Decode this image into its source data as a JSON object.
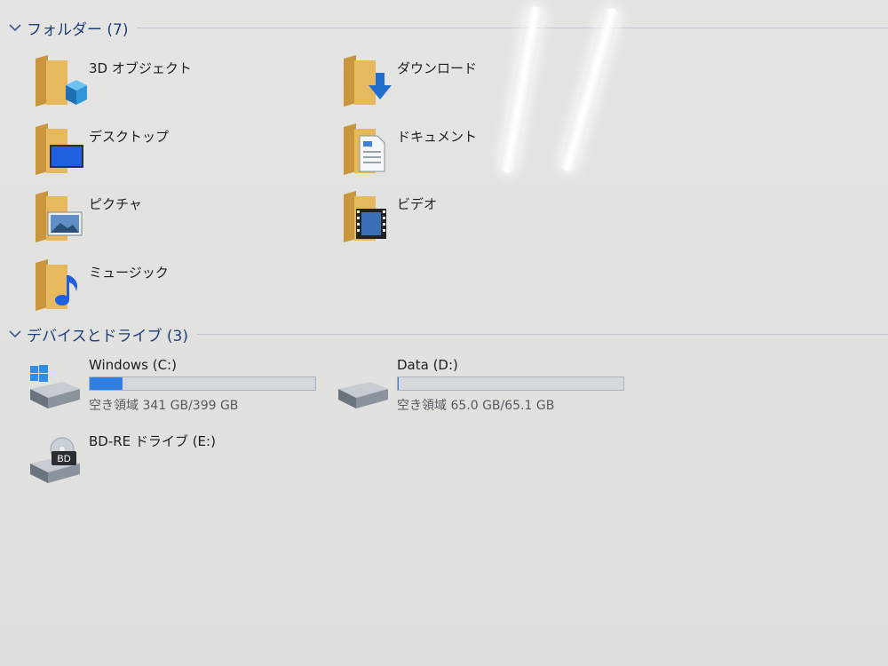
{
  "folders_section": {
    "title": "フォルダー (7)",
    "items": [
      {
        "label": "3D オブジェクト",
        "icon": "3d-objects-folder-icon"
      },
      {
        "label": "ダウンロード",
        "icon": "downloads-folder-icon"
      },
      {
        "label": "デスクトップ",
        "icon": "desktop-folder-icon"
      },
      {
        "label": "ドキュメント",
        "icon": "documents-folder-icon"
      },
      {
        "label": "ピクチャ",
        "icon": "pictures-folder-icon"
      },
      {
        "label": "ビデオ",
        "icon": "videos-folder-icon"
      },
      {
        "label": "ミュージック",
        "icon": "music-folder-icon"
      }
    ]
  },
  "devices_section": {
    "title": "デバイスとドライブ (3)",
    "drives": [
      {
        "name": "Windows (C:)",
        "free_text": "空き領域 341 GB/399 GB",
        "used_fraction": 0.145,
        "icon": "windows-drive-icon"
      },
      {
        "name": "Data (D:)",
        "free_text": "空き領域 65.0 GB/65.1 GB",
        "used_fraction": 0.002,
        "icon": "hard-drive-icon"
      },
      {
        "name": "BD-RE ドライブ (E:)",
        "icon": "bd-drive-icon"
      }
    ]
  },
  "colors": {
    "accent": "#2f7fe0",
    "header_text": "#1f3f78",
    "folder": "#dcae57"
  }
}
